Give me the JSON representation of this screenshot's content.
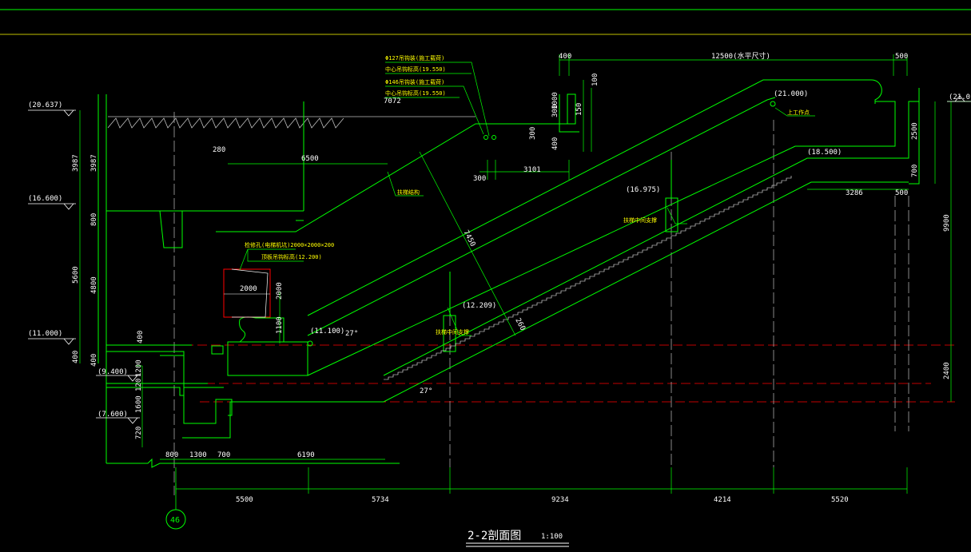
{
  "title": {
    "text": "2-2剖面图",
    "scale": "1:100"
  },
  "axis_label": "46",
  "colors": {
    "bg": "#000000",
    "green": "#00ff00",
    "white": "#ffffff",
    "yellow": "#ffff00",
    "red": "#ff0000",
    "gray": "#c0c0c0",
    "cyan": "#00ffff"
  },
  "levels": {
    "l1": "(20.637)",
    "l2": "(16.600)",
    "l3": "(11.000)",
    "l4": "(9.400)",
    "l5": "(7.600)",
    "r1": "(21.0",
    "top_landing": "(21.000)",
    "upper_mid": "(18.500)",
    "mid_support": "(16.975)",
    "low_support": "(12.209)",
    "low_landing": "(11.100)"
  },
  "dims": {
    "top_400": "400",
    "top_span": "12500(水平尺寸)",
    "top_500": "500",
    "left_3987a": "3987",
    "left_3987b": "3987",
    "left_800": "800",
    "left_5600": "5600",
    "left_4800": "4800",
    "left_400a": "400",
    "left_400b": "400",
    "left_1200": "1200",
    "left_120": "120",
    "left_1600": "1600",
    "left_720": "720",
    "left_400c": "400",
    "d_280": "280",
    "d_6500": "6500",
    "d_7072": "7072",
    "d_2000w": "2000",
    "d_2000h": "2000",
    "d_1100": "1100",
    "d_7450": "7450",
    "d_260": "260",
    "d_300a": "300",
    "d_1000": "1000",
    "d_300b": "300",
    "d_400": "400",
    "d_150": "150",
    "d_100": "100",
    "d_300c": "300",
    "d_3101": "3101",
    "r_2500": "2500",
    "r_700": "700",
    "r_9900": "9900",
    "r_2400": "2400",
    "r_3286": "3286",
    "r_500": "500",
    "b_800": "800",
    "b_1300": "1300",
    "b_700": "700",
    "b_6190": "6190",
    "bot": [
      "5500",
      "5734",
      "9234",
      "4214",
      "5520"
    ],
    "ang_upper": "27°",
    "ang_lower": "27°"
  },
  "annotations": {
    "a1": "Φ127吊钩装(施工载荷)",
    "a2": "中心吊钩标高(19.550)",
    "a3": "Φ146吊钩装(施工载荷)",
    "a4": "中心吊钩标高(19.550)",
    "a5": "上工作点",
    "a6": "扶梯结构",
    "a7": "扶梯中间支撑",
    "a8": "扶梯中间支撑",
    "a9": "检修孔(电梯机坑)2000×2000×200",
    "a10": "顶板吊钩标高(12.200)"
  }
}
